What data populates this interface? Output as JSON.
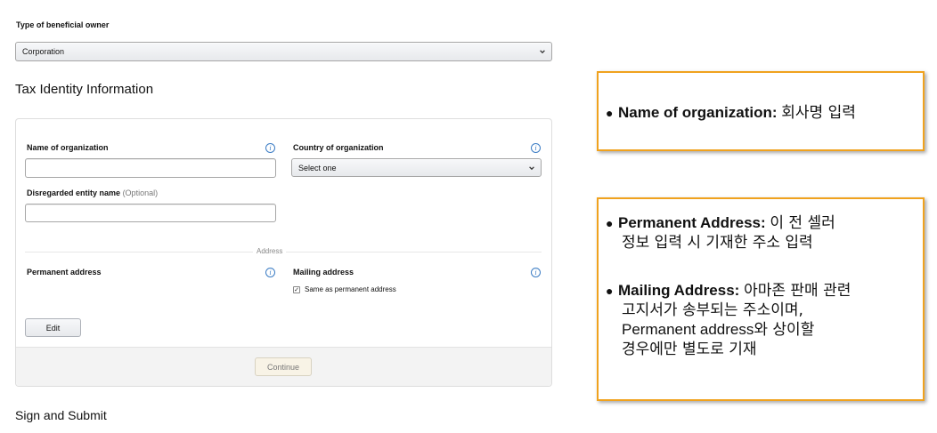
{
  "beneficial_owner": {
    "label": "Type of beneficial owner",
    "selected": "Corporation"
  },
  "tax_identity": {
    "title": "Tax Identity Information",
    "name_of_organization": {
      "label": "Name of organization",
      "value": ""
    },
    "country_of_organization": {
      "label": "Country of organization",
      "selected": "Select one"
    },
    "disregarded_entity": {
      "label": "Disregarded entity name",
      "optional": "(Optional)",
      "value": ""
    },
    "address_divider": "Address",
    "permanent_address": {
      "label": "Permanent address"
    },
    "mailing_address": {
      "label": "Mailing address",
      "checkbox_label": "Same as permanent address",
      "checked": true
    },
    "edit_button": "Edit",
    "continue_button": "Continue",
    "info_icon_glyph": "i"
  },
  "sign_submit": {
    "title": "Sign and Submit"
  },
  "annotations": {
    "note1": {
      "term": "Name of organization:",
      "desc": "회사명 입력"
    },
    "note2": {
      "permanent_term": "Permanent Address:",
      "permanent_desc_1": "이 전 셀러",
      "permanent_desc_2": "정보 입력 시 기재한 주소 입력",
      "mailing_term": "Mailing Address:",
      "mailing_desc_1": "아마존 판매 관련",
      "mailing_desc_2": "고지서가 송부되는 주소이며,",
      "mailing_desc_3_en": "Permanent address",
      "mailing_desc_3_kr": "와 상이할",
      "mailing_desc_4": "경우에만 별도로 기재"
    },
    "accent_color": "#f0a21e"
  }
}
